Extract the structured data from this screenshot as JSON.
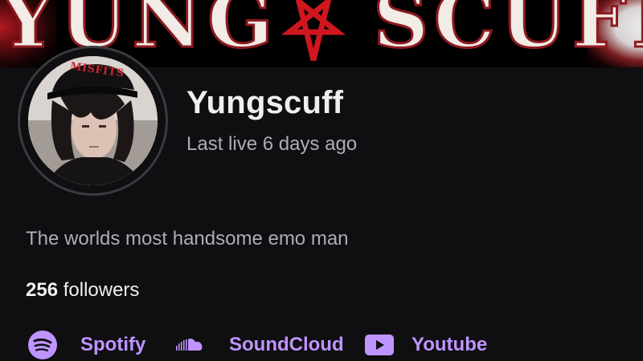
{
  "banner": {
    "text": "YUNG   SCUFF"
  },
  "channel": {
    "name": "Yungscuff",
    "last_live": "Last live 6 days ago",
    "bio": "The worlds most handsome emo man",
    "followers_count": "256",
    "followers_label": "followers",
    "avatar_hat_text": "MISFITS"
  },
  "socials": [
    {
      "label": "Spotify",
      "icon": "spotify-icon"
    },
    {
      "label": "SoundCloud",
      "icon": "soundcloud-icon"
    },
    {
      "label": "Youtube",
      "icon": "youtube-icon"
    }
  ],
  "colors": {
    "background": "#0f0e11",
    "accent": "#bf94ff",
    "text_primary": "#efeff1",
    "text_secondary": "#adadb8",
    "banner_red": "#c4141c"
  }
}
